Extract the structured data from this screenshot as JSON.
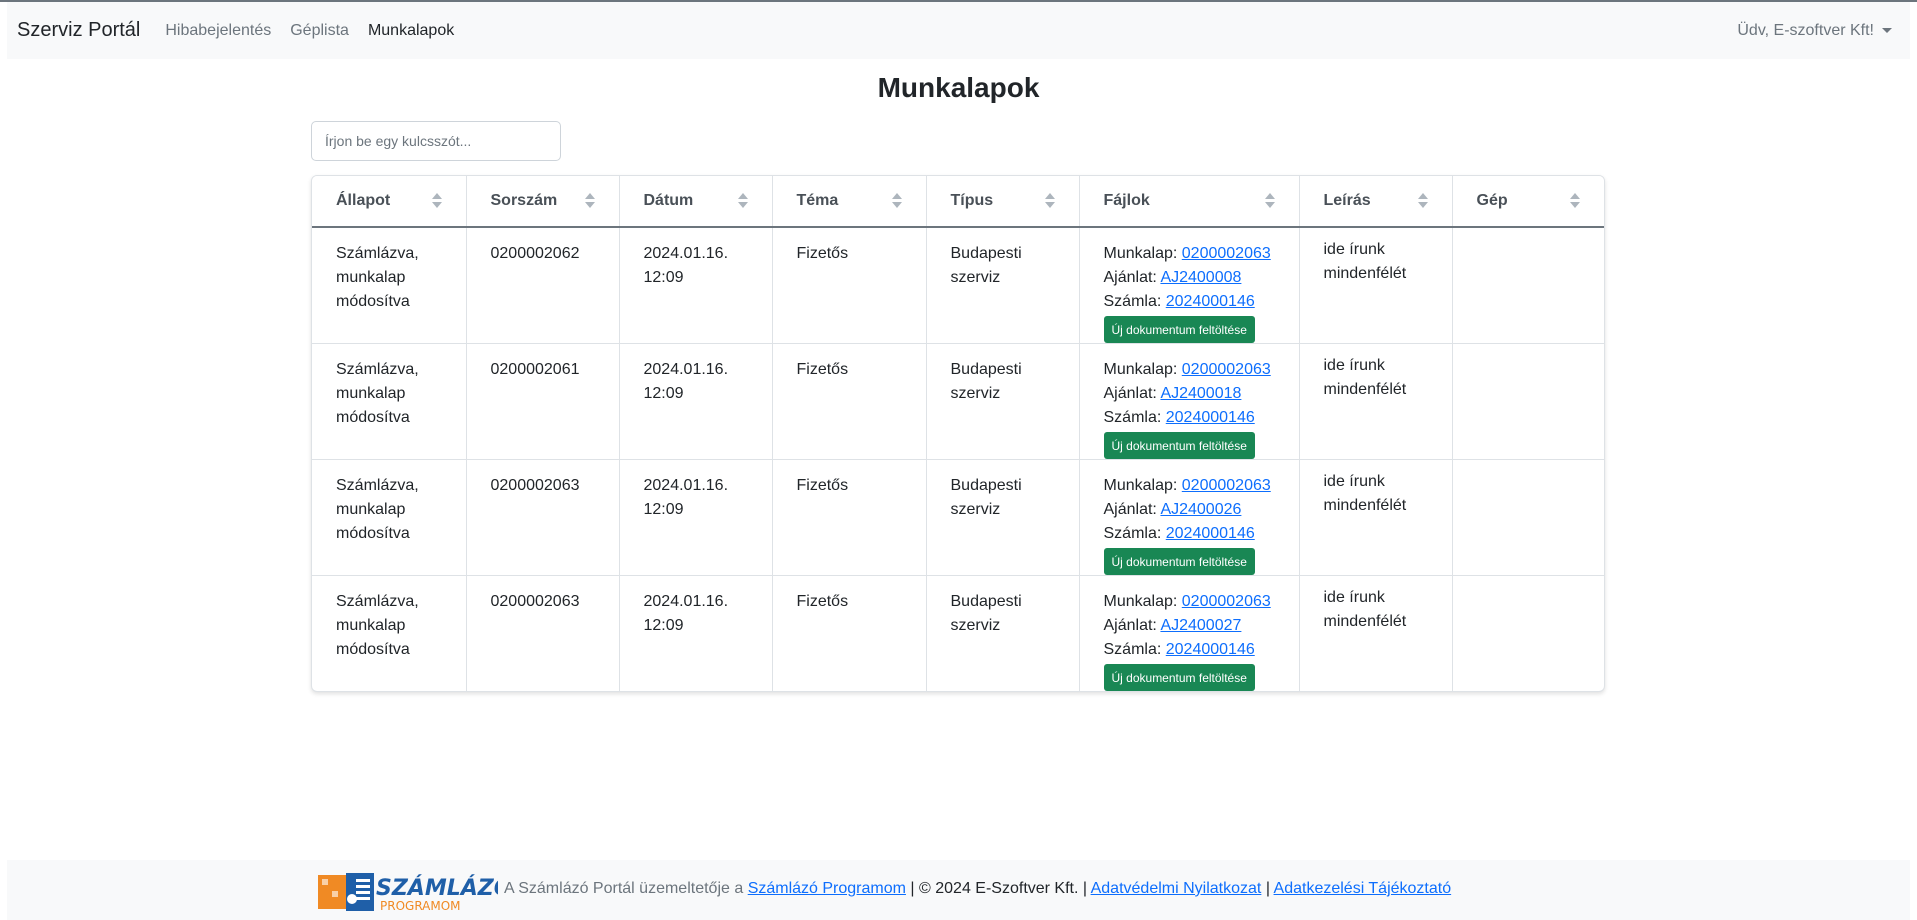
{
  "navbar": {
    "brand": "Szerviz Portál",
    "links": [
      "Hibabejelentés",
      "Géplista",
      "Munkalapok"
    ],
    "user": "Üdv, E-szoftver Kft!"
  },
  "page": {
    "title": "Munkalapok",
    "search_placeholder": "Írjon be egy kulcsszót..."
  },
  "table": {
    "headers": [
      "Állapot",
      "Sorszám",
      "Dátum",
      "Téma",
      "Típus",
      "Fájlok",
      "Leírás",
      "Gép"
    ],
    "file_labels": {
      "munkalap": "Munkalap:",
      "ajanlat": "Ajánlat:",
      "szamla": "Számla:"
    },
    "upload_label": "Új dokumentum feltöltése",
    "rows": [
      {
        "allapot_1": "Számlázva,",
        "allapot_2": "munkalap",
        "allapot_3": "módosítva",
        "sorszam": "0200002062",
        "datum_1": "2024.01.16.",
        "datum_2": "12:09",
        "tema": "Fizetős",
        "tipus_1": "Budapesti",
        "tipus_2": "szerviz",
        "munkalap": "0200002063",
        "ajanlat": "AJ2400008",
        "szamla": "2024000146",
        "leiras_1": "ide írunk",
        "leiras_2": "mindenfélét",
        "gep": ""
      },
      {
        "allapot_1": "Számlázva,",
        "allapot_2": "munkalap",
        "allapot_3": "módosítva",
        "sorszam": "0200002061",
        "datum_1": "2024.01.16.",
        "datum_2": "12:09",
        "tema": "Fizetős",
        "tipus_1": "Budapesti",
        "tipus_2": "szerviz",
        "munkalap": "0200002063",
        "ajanlat": "AJ2400018",
        "szamla": "2024000146",
        "leiras_1": "ide írunk",
        "leiras_2": "mindenfélét",
        "gep": ""
      },
      {
        "allapot_1": "Számlázva,",
        "allapot_2": "munkalap",
        "allapot_3": "módosítva",
        "sorszam": "0200002063",
        "datum_1": "2024.01.16.",
        "datum_2": "12:09",
        "tema": "Fizetős",
        "tipus_1": "Budapesti",
        "tipus_2": "szerviz",
        "munkalap": "0200002063",
        "ajanlat": "AJ2400026",
        "szamla": "2024000146",
        "leiras_1": "ide írunk",
        "leiras_2": "mindenfélét",
        "gep": ""
      },
      {
        "allapot_1": "Számlázva,",
        "allapot_2": "munkalap",
        "allapot_3": "módosítva",
        "sorszam": "0200002063",
        "datum_1": "2024.01.16.",
        "datum_2": "12:09",
        "tema": "Fizetős",
        "tipus_1": "Budapesti",
        "tipus_2": "szerviz",
        "munkalap": "0200002063",
        "ajanlat": "AJ2400027",
        "szamla": "2024000146",
        "leiras_1": "ide írunk",
        "leiras_2": "mindenfélét",
        "gep": ""
      }
    ]
  },
  "footer": {
    "logo_text_1": "SZÁMLÁZÓ",
    "logo_text_2": "PROGRAMOM",
    "text_1": "A Számlázó Portál üzemeltetője a",
    "link_1": "Számlázó Programom",
    "text_2": "| © 2024 E-Szoftver Kft. |",
    "link_2": "Adatvédelmi Nyilatkozat",
    "text_3": "|",
    "link_3": "Adatkezelési Tájékoztató"
  },
  "colors": {
    "link": "#0d6efd",
    "upload_button": "#198754",
    "navbar_bg": "#f8f9fa",
    "logo_orange": "#f08a24",
    "logo_blue": "#1f5fa8"
  }
}
